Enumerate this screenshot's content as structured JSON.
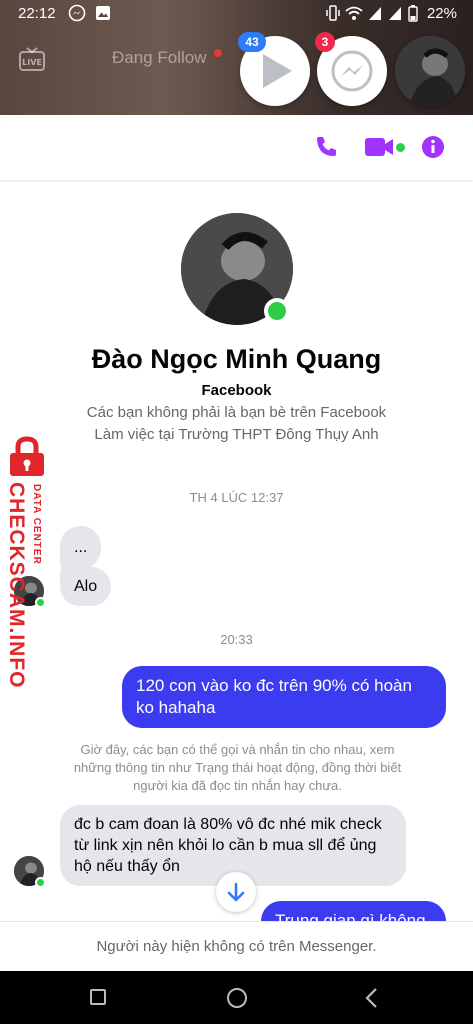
{
  "status_bar": {
    "time": "22:12",
    "battery": "22%"
  },
  "background": {
    "live_label": "LIVE",
    "tab_text": "Đang Follow"
  },
  "chat_heads": {
    "video_badge": "43",
    "messenger_badge": "3"
  },
  "colors": {
    "accent": "#a033ff",
    "outgoing_bubble": "#3b3cf0",
    "incoming_bubble": "#e4e6eb",
    "online": "#31cc46",
    "watermark": "#e0262a"
  },
  "profile": {
    "name": "Đào Ngọc Minh Quang",
    "platform": "Facebook",
    "friend_status": "Các bạn không phải là bạn bè trên Facebook",
    "work": "Làm việc tại Trường THPT Đông Thụy Anh"
  },
  "messages": {
    "timestamp_1": "TH 4 LÚC 12:37",
    "incoming_1": "...",
    "incoming_2": "Alo",
    "timestamp_2": "20:33",
    "outgoing_1": "120 con vào ko đc trên 90% có hoàn ko hahaha",
    "notice": "Giờ đây, các bạn có thể gọi và nhắn tin cho nhau, xem những thông tin như Trạng thái hoạt động, đồng thời biết người kia đã đọc tin nhắn hay chưa.",
    "incoming_3": "đc b cam đoan là 80% vô đc nhé mik check từ link xịn nên khỏi lo cần b mua sll để ủng hộ nếu thấy ổn",
    "outgoing_2": "Trung gian gì không"
  },
  "footer": {
    "text": "Người này hiện không có trên Messenger."
  },
  "watermark": {
    "main": "CHECKSCAM.INFO",
    "sub": "DATA CENTER"
  }
}
